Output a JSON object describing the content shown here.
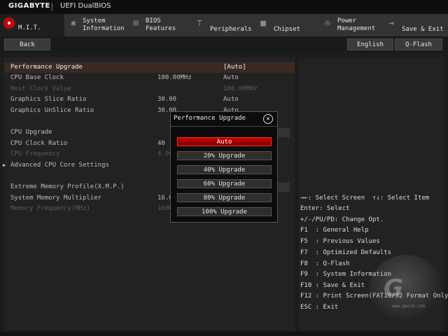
{
  "header": {
    "brand": "GIGABYTE",
    "product": "UEFI DualBIOS"
  },
  "tabs": [
    {
      "label": "M.I.T.",
      "icon": "mit-red-dot"
    },
    {
      "label": "System\nInformation",
      "icon": "gear-icon"
    },
    {
      "label": "BIOS\nFeatures",
      "icon": "bios-icon"
    },
    {
      "label": "Peripherals",
      "icon": "peripherals-icon"
    },
    {
      "label": "Chipset",
      "icon": "chip-icon"
    },
    {
      "label": "Power\nManagement",
      "icon": "power-icon"
    },
    {
      "label": "Save & Exit",
      "icon": "exit-icon"
    }
  ],
  "subbar": {
    "back": "Back",
    "language": "English",
    "qflash": "Q-Flash"
  },
  "settings": [
    {
      "label": "Performance Upgrade",
      "v1": "",
      "v2": "[Auto]"
    },
    {
      "label": "CPU Base Clock",
      "v1": "100.00MHz",
      "v2": "Auto"
    },
    {
      "label": "Host Clock Value",
      "v1": "",
      "v2": "100.00MHz"
    },
    {
      "label": "Graphics Slice Ratio",
      "v1": "30.00",
      "v2": "Auto"
    },
    {
      "label": "Graphics UnSlice Ratio",
      "v1": "30.00",
      "v2": "Auto"
    },
    {
      "label": "CPU Upgrade",
      "v1": "",
      "v2": ""
    },
    {
      "label": "CPU Clock Ratio",
      "v1": "40",
      "v2": ""
    },
    {
      "label": "CPU Frequency",
      "v1": "4.00",
      "v2": ""
    },
    {
      "label": "Advanced CPU Core Settings",
      "v1": "",
      "v2": ""
    },
    {
      "label": "Extreme Memory Profile(X.M.P.)",
      "v1": "",
      "v2": ""
    },
    {
      "label": "System Memory Multiplier",
      "v1": "16.0",
      "v2": ""
    },
    {
      "label": "Memory Frequency(MHz)",
      "v1": "1600",
      "v2": ""
    }
  ],
  "dialog": {
    "title": "Performance Upgrade",
    "options": [
      "Auto",
      "20% Upgrade",
      "40% Upgrade",
      "60% Upgrade",
      "80% Upgrade",
      "100% Upgrade"
    ],
    "selected": "Auto"
  },
  "help": [
    "→←: Select Screen  ↑↓: Select Item",
    "Enter: Select",
    "+/-/PU/PD: Change Opt.",
    "F1  : General Help",
    "F5  : Previous Values",
    "F7  : Optimized Defaults",
    "F8  : Q-Flash",
    "F9  : System Information",
    "F10 : Save & Exit",
    "F12 : Print Screen(FAT16/32 Format Only)",
    "ESC : Exit"
  ],
  "colors": {
    "accent": "#d10000",
    "selected_row": "#3a2a22"
  },
  "watermark": {
    "text": "G",
    "sub": "www.gecid.com"
  }
}
